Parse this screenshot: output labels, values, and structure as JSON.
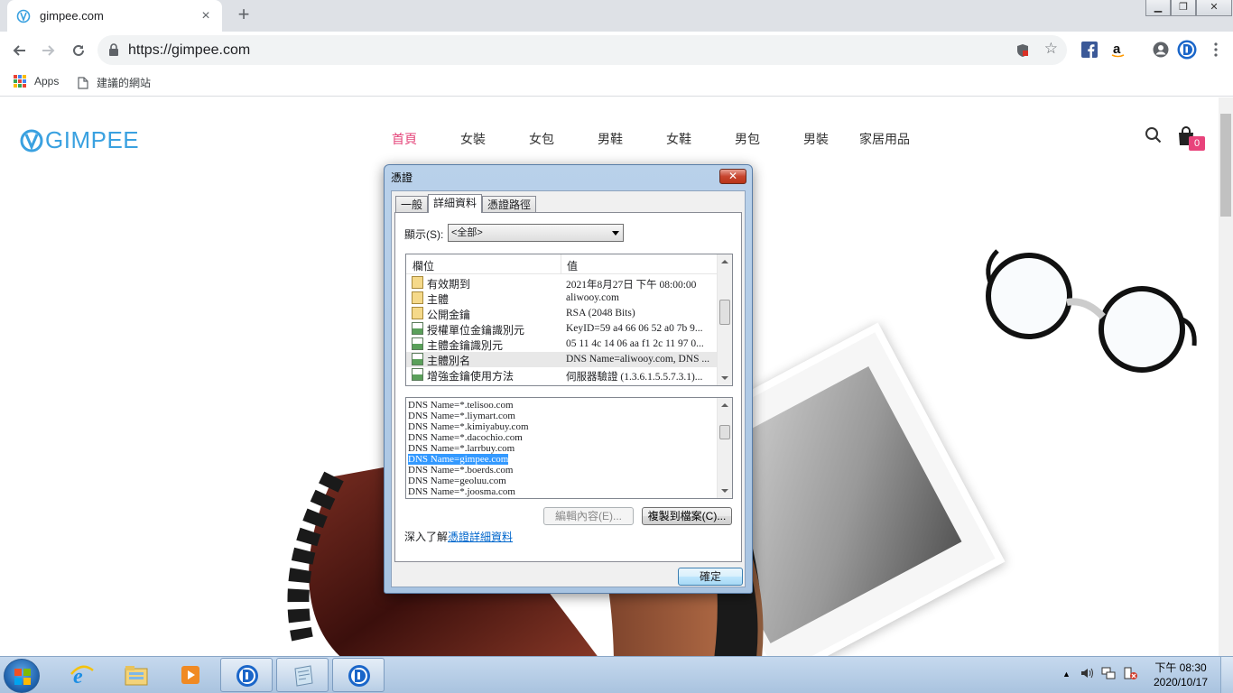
{
  "browser": {
    "tab_title": "gimpee.com",
    "tab_close": "×",
    "new_tab": "+",
    "url": "https://gimpee.com",
    "bookmarks": [
      {
        "label": "Apps"
      },
      {
        "label": "建議的網站"
      }
    ],
    "window_controls": {
      "minimize": "▁",
      "restore": "❐",
      "close": "✕"
    }
  },
  "site": {
    "logo": "GIMPEE",
    "nav": [
      "首頁",
      "女裝",
      "女包",
      "男鞋",
      "女鞋",
      "男包",
      "男裝",
      "家居用品"
    ],
    "active_nav_index": 0,
    "cart_count": "0",
    "colors": {
      "brand": "#3aa1e0",
      "accent": "#e4457a"
    }
  },
  "dialog": {
    "title": "憑證",
    "close": "✕",
    "tabs": [
      "一般",
      "詳細資料",
      "憑證路徑"
    ],
    "selected_tab": 1,
    "show_label": "顯示(S):",
    "show_value": "<全部>",
    "columns": {
      "field": "欄位",
      "value": "值"
    },
    "fields": [
      {
        "name": "有效期到",
        "value": "2021年8月27日 下午 08:00:00",
        "icon": "certificate-field-icon"
      },
      {
        "name": "主體",
        "value": "aliwooy.com",
        "icon": "certificate-field-icon"
      },
      {
        "name": "公開金鑰",
        "value": "RSA (2048 Bits)",
        "icon": "certificate-field-icon"
      },
      {
        "name": "授權單位金鑰識別元",
        "value": "KeyID=59 a4 66 06 52 a0 7b 9...",
        "icon": "extension-icon"
      },
      {
        "name": "主體金鑰識別元",
        "value": "05 11 4c 14 06 aa f1 2c 11 97 0...",
        "icon": "extension-icon"
      },
      {
        "name": "主體別名",
        "value": "DNS Name=aliwooy.com, DNS ...",
        "icon": "extension-icon",
        "selected": true
      },
      {
        "name": "增強金鑰使用方法",
        "value": "伺服器驗證 (1.3.6.1.5.5.7.3.1)...",
        "icon": "extension-icon"
      }
    ],
    "value_lines": [
      {
        "text": "DNS Name=*.telisoo.com"
      },
      {
        "text": "DNS Name=*.liymart.com"
      },
      {
        "text": "DNS Name=*.kimiyabuy.com"
      },
      {
        "text": "DNS Name=*.dacochio.com"
      },
      {
        "text": "DNS Name=*.larrbuy.com"
      },
      {
        "text": "DNS Name=gimpee.com",
        "selected": true
      },
      {
        "text": "DNS Name=*.boerds.com"
      },
      {
        "text": "DNS Name=geoluu.com"
      },
      {
        "text": "DNS Name=*.joosma.com"
      }
    ],
    "edit_button": "編輯內容(E)...",
    "copy_button": "複製到檔案(C)...",
    "learn_prefix": "深入了解",
    "learn_link": "憑證詳細資料",
    "ok_button": "確定"
  },
  "taskbar": {
    "time": "下午 08:30",
    "date": "2020/10/17",
    "tray_up": "▲"
  }
}
